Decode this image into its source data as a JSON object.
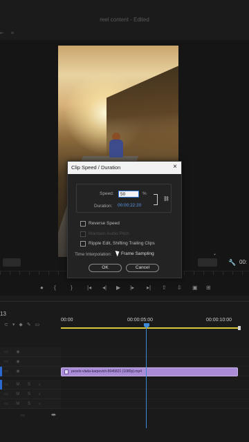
{
  "window": {
    "title": "reel content - Edited"
  },
  "timecodes": {
    "program_right": "00:"
  },
  "dialog": {
    "title": "Clip Speed / Duration",
    "close_glyph": "×",
    "speed_label": "Speed:",
    "speed_value": "50",
    "percent": "%",
    "duration_label": "Duration:",
    "duration_value": "00:00:22:20",
    "checkboxes": [
      {
        "label": "Reverse Speed",
        "enabled": true,
        "checked": false
      },
      {
        "label": "Maintain Audio Pitch",
        "enabled": false,
        "checked": false
      },
      {
        "label": "Ripple Edit, Shifting Trailing Clips",
        "enabled": true,
        "checked": false
      }
    ],
    "interpolation_label": "Time Interpolation:",
    "interpolation_value": "Frame Sampling",
    "ok_label": "OK",
    "cancel_label": "Cancel"
  },
  "timeline": {
    "sequence_label": "13",
    "ruler": [
      "00:00",
      "00:00:05:00",
      "00:00:10:00"
    ],
    "clip_label": "pexels-vlada-karpovich-8045821 (1080p).mp4"
  },
  "colors": {
    "playhead": "#3c8ad8",
    "clip": "#a98bd8",
    "work_area": "#d9c93a"
  }
}
